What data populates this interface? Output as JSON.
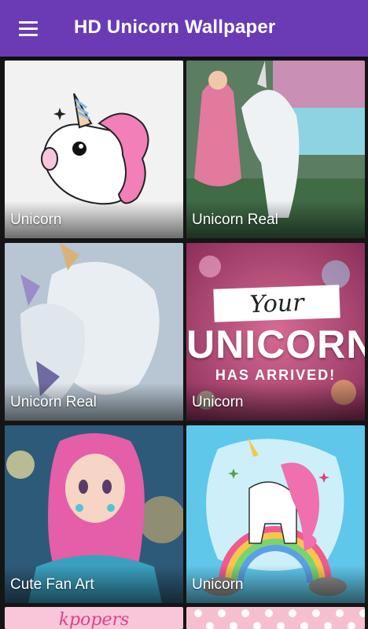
{
  "appbar": {
    "title": "HD Unicorn Wallpaper",
    "menu_icon": "hamburger-menu-icon",
    "color": "#6a3bb5"
  },
  "tiles": [
    {
      "label": "Unicorn"
    },
    {
      "label": "Unicorn Real"
    },
    {
      "label": "Unicorn Real"
    },
    {
      "label": "Unicorn",
      "art_text": {
        "line1": "Your",
        "line2": "UNICORN",
        "line3": "HAS ARRIVED!"
      }
    },
    {
      "label": "Cute Fan Art"
    },
    {
      "label": "Unicorn"
    },
    {
      "label": "",
      "art_text": "kpopers"
    },
    {
      "label": ""
    }
  ]
}
